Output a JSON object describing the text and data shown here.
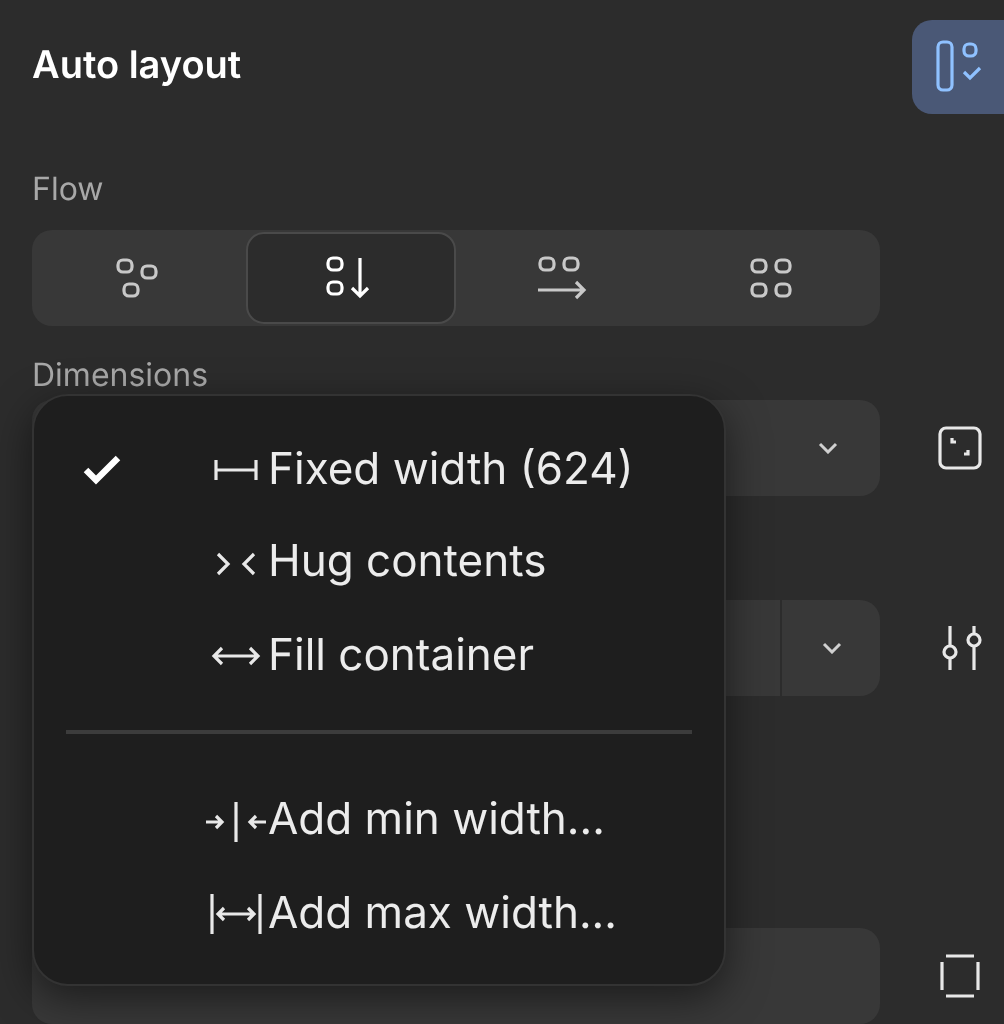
{
  "panel": {
    "title": "Auto layout",
    "layout_toggle": {
      "on": true
    }
  },
  "flow": {
    "label": "Flow",
    "options": [
      {
        "selected": false
      },
      {
        "selected": true
      },
      {
        "selected": false
      },
      {
        "selected": false
      }
    ]
  },
  "dimensions": {
    "label": "Dimensions"
  },
  "menu": {
    "sections": [
      [
        {
          "label": "Fixed width (624)",
          "checked": true
        },
        {
          "label": "Hug contents",
          "checked": false
        },
        {
          "label": "Fill container",
          "checked": false
        }
      ],
      [
        {
          "label": "Add min width...",
          "checked": false
        },
        {
          "label": "Add max width...",
          "checked": false
        }
      ]
    ]
  }
}
